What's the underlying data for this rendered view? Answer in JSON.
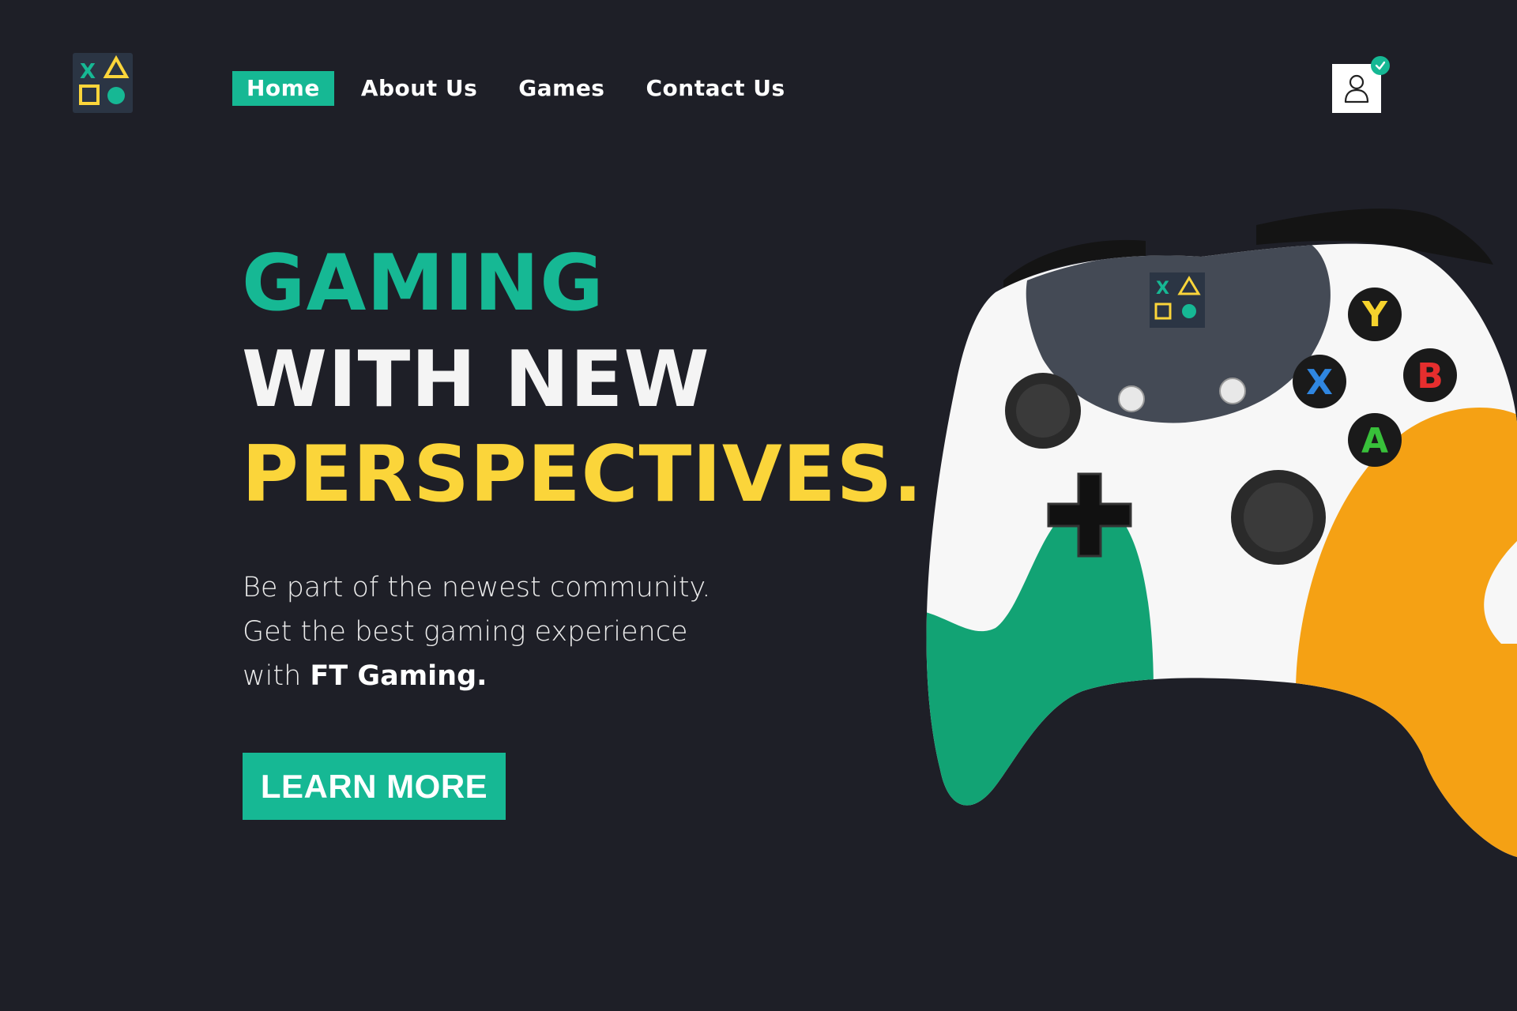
{
  "brand": {
    "logo_symbols": [
      "X",
      "triangle",
      "square",
      "circle"
    ],
    "colors": {
      "accent": "#16b894",
      "yellow": "#fbd53a",
      "orange": "#f5a114",
      "background": "#1e1f27"
    }
  },
  "nav": {
    "items": [
      {
        "label": "Home",
        "active": true
      },
      {
        "label": "About Us",
        "active": false
      },
      {
        "label": "Games",
        "active": false
      },
      {
        "label": "Contact Us",
        "active": false
      }
    ]
  },
  "header": {
    "profile_icon": "user-icon",
    "badge_icon": "check-icon"
  },
  "hero": {
    "line1": "GAMING",
    "line2": "WITH NEW",
    "line3": "PERSPECTIVES.",
    "description": {
      "line1": "Be part of the newest community.",
      "line2": "Get the best gaming experience",
      "line3_prefix": "with ",
      "line3_brand": "FT Gaming."
    },
    "cta_label": "LEARN MORE"
  },
  "controller": {
    "buttons": {
      "y": "Y",
      "b": "B",
      "x": "X",
      "a": "A"
    }
  }
}
